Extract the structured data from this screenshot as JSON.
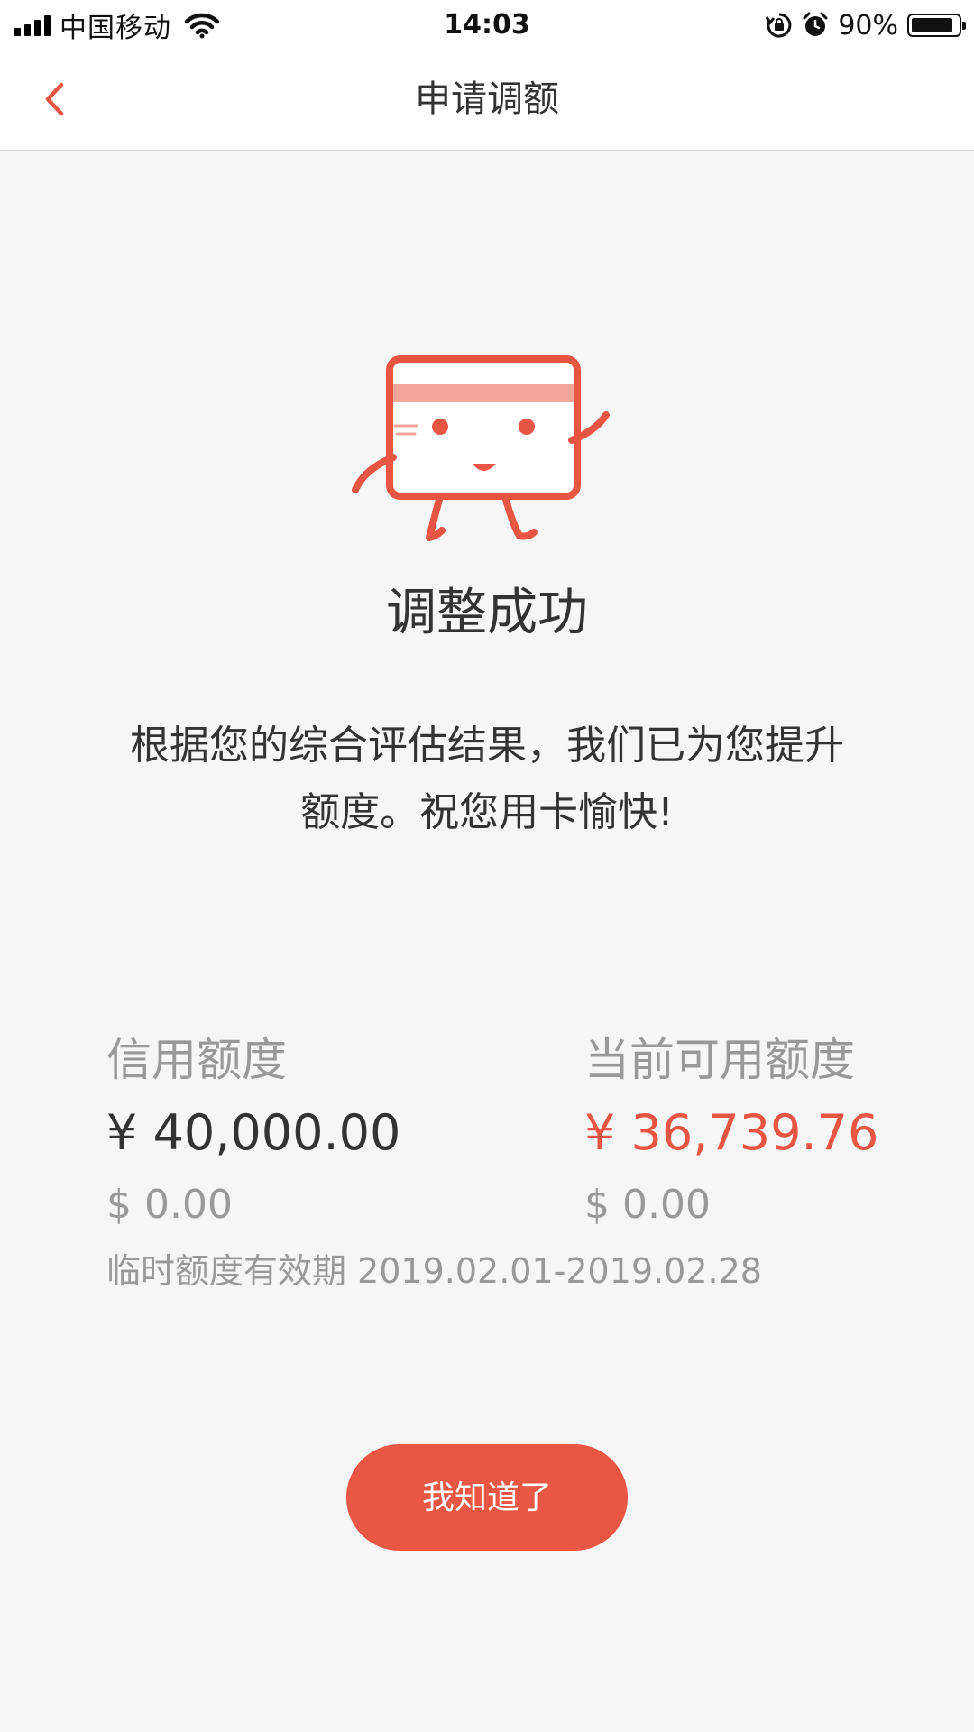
{
  "status_bar": {
    "carrier": "中国移动",
    "time": "14:03",
    "battery_percent": "90%",
    "battery_level": 0.9,
    "icons": [
      "signal-icon",
      "wifi-icon",
      "rotation-lock-icon",
      "alarm-icon",
      "battery-icon"
    ]
  },
  "nav": {
    "title": "申请调额",
    "back_icon": "chevron-left-icon"
  },
  "colors": {
    "accent": "#ea5644",
    "text_primary": "#333333",
    "text_secondary": "#999999",
    "background": "#f6f6f6"
  },
  "result": {
    "illustration": "happy-card-mascot-icon",
    "title": "调整成功",
    "message": "根据您的综合评估结果，我们已为您提升额度。祝您用卡愉快!"
  },
  "limits": {
    "credit": {
      "label": "信用额度",
      "cny": "¥ 40,000.00",
      "usd": "$ 0.00"
    },
    "available": {
      "label": "当前可用额度",
      "cny": "¥ 36,739.76",
      "usd": "$ 0.00"
    },
    "temp_validity": "临时额度有效期 2019.02.01-2019.02.28"
  },
  "actions": {
    "confirm_label": "我知道了"
  }
}
